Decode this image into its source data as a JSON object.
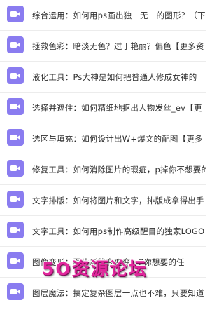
{
  "items": [
    {
      "title": "综合运用：如何用ps画出独一无二的图形？（下"
    },
    {
      "title": "拯救色彩：暗淡无色？过于艳丽？偏色【更多资"
    },
    {
      "title": "液化工具：Ps大神是如何把普通人修成女神的"
    },
    {
      "title": "选择并遮住：如何精细地抠出人物发丝_ev【更"
    },
    {
      "title": "选区与填充：如何设计出W+爆文的配图【更多"
    },
    {
      "title": "修复工具：如何消除图片的瑕疵，p掉你不想要的"
    },
    {
      "title": "文字排版：如何将图片和文字，排版成拿得出手"
    },
    {
      "title": "文字工具：如何用ps制作高级醒目的独家LOGO"
    },
    {
      "title": "图像变形：图片形状变变变，P你想要的任"
    },
    {
      "title": "图层魔法：搞定复杂图层一点也不难，只要知道"
    }
  ],
  "icon": "video-camera-icon",
  "accent_color": "#8a7cf0",
  "watermark": "5O资源论坛"
}
